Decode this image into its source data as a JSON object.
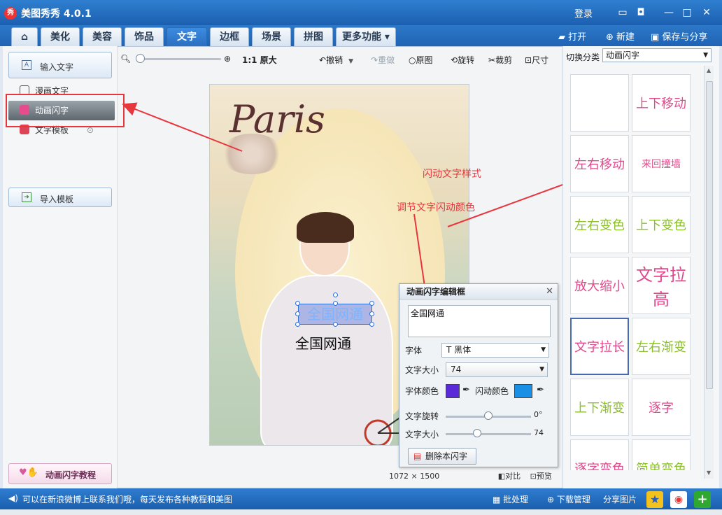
{
  "window": {
    "app_logo": "秀",
    "title": "美图秀秀 4.0.1",
    "login": "登录",
    "controls": [
      "message-icon",
      "skin-icon",
      "minimize-icon",
      "maximize-icon",
      "close-icon"
    ]
  },
  "tabs": [
    {
      "label": "⌂",
      "name": "home"
    },
    {
      "label": "美化",
      "name": "beautify"
    },
    {
      "label": "美容",
      "name": "beauty"
    },
    {
      "label": "饰品",
      "name": "accessories"
    },
    {
      "label": "文字",
      "name": "text",
      "active": true
    },
    {
      "label": "边框",
      "name": "border"
    },
    {
      "label": "场景",
      "name": "scene"
    },
    {
      "label": "拼图",
      "name": "collage"
    },
    {
      "label": "更多功能 ▾",
      "name": "more"
    }
  ],
  "file_actions": {
    "open": "打开",
    "new": "新建",
    "save_share": "保存与分享"
  },
  "left_panel": {
    "input_text": "输入文字",
    "comic_text": "漫画文字",
    "animated_text": "动画闪字",
    "text_template": "文字模板",
    "import_template": "导入模板",
    "tutorial": "动画闪字教程"
  },
  "toolbar": {
    "actual_size": "1:1 原大",
    "undo": "撤销",
    "redo": "重做",
    "original": "原图",
    "rotate": "旋转",
    "crop": "裁剪",
    "size": "尺寸"
  },
  "canvas": {
    "paris_logo": "Paris",
    "selected_text": "全国网通",
    "plain_text": "全国网通",
    "dimensions": "1072 × 1500",
    "compare": "对比",
    "preview": "预览"
  },
  "annotations": {
    "style_note": "闪动文字样式",
    "color_note": "调节文字闪动颜色"
  },
  "dialog": {
    "title": "动画闪字编辑框",
    "close": "✕",
    "text_value": "全国网通",
    "font_label": "字体",
    "font_value": "黑体",
    "size_label": "文字大小",
    "size_value": "74",
    "font_color_label": "字体颜色",
    "flash_color_label": "闪动颜色",
    "font_color": "#5b2ad8",
    "flash_color": "#1a8fe6",
    "rotate_label": "文字旋转",
    "rotate_value": "0°",
    "rotate_fraction": 0.5,
    "scale_label": "文字大小",
    "scale_value": "74",
    "scale_fraction": 0.37,
    "delete_button": "删除本闪字"
  },
  "right_panel": {
    "switch_label": "切换分类",
    "category": "动画闪字",
    "effects": [
      {
        "label": "",
        "color": "#e04a8c"
      },
      {
        "label": "上下移动",
        "color": "#e04a8c"
      },
      {
        "label": "左右移动",
        "color": "#e04a8c"
      },
      {
        "label": "来回撞墙",
        "color": "#e04a8c"
      },
      {
        "label": "左右变色",
        "color": "#8bbf2c"
      },
      {
        "label": "上下变色",
        "color": "#8bbf2c"
      },
      {
        "label": "放大缩小",
        "color": "#e04a8c"
      },
      {
        "label": "文字拉高",
        "color": "#e04a8c"
      },
      {
        "label": "文字拉长",
        "color": "#e04a8c"
      },
      {
        "label": "左右渐变",
        "color": "#8bbf2c"
      },
      {
        "label": "上下渐变",
        "color": "#8bbf2c"
      },
      {
        "label": "逐字",
        "color": "#e04a8c"
      },
      {
        "label": "逐字变色",
        "color": "#e04a8c"
      },
      {
        "label": "简单变色",
        "color": "#8bbf2c"
      }
    ]
  },
  "statusbar": {
    "message": "可以在新浪微博上联系我们哦，每天发布各种教程和美图",
    "batch": "批处理",
    "download": "下载管理",
    "share": "分享图片"
  }
}
